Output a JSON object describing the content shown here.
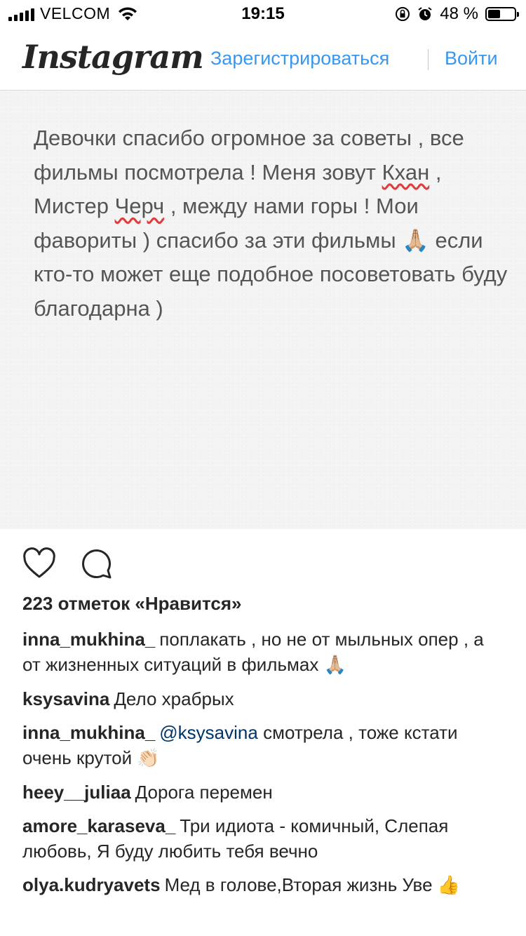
{
  "status_bar": {
    "carrier": "VELCOM",
    "time": "19:15",
    "battery": "48 %",
    "battery_level": 0.48
  },
  "nav": {
    "logo": "Instagram",
    "signup_label": "Зарегистрироваться",
    "login_label": "Войти"
  },
  "post": {
    "text_parts": {
      "p1": "Девочки спасибо огромное за советы , все фильмы посмотрела ! Меня зовут ",
      "w1": "Кхан",
      "p2": " , Мистер ",
      "w2": "Черч",
      "p3": " , между нами горы ! Мои фавориты ) спасибо за эти фильмы ",
      "emoji": "🙏🏼",
      "p4": " если кто-то может еще подобное посоветовать буду благодарна )"
    }
  },
  "actions": {
    "like_icon": "heart-icon",
    "comment_icon": "comment-icon"
  },
  "likes": "223 отметок «Нравится»",
  "comments": [
    {
      "user": "inna_mukhina_",
      "text": "поплакать , но не от мыльных опер , а от жизненных ситуаций в фильмах",
      "emoji": "🙏🏼"
    },
    {
      "user": "ksysavina",
      "text": "Дело храбрых"
    },
    {
      "user": "inna_mukhina_",
      "mention": "@ksysavina",
      "text": "смотрела , тоже кстати очень крутой",
      "emoji": "👏🏻"
    },
    {
      "user": "heey__juliaa",
      "text": "Дорога перемен"
    },
    {
      "user": "amore_karaseva_",
      "text": "Три идиота - комичный, Слепая любовь, Я буду любить тебя вечно"
    },
    {
      "user": "olya.kudryavets",
      "text": "Мед в голове,Вторая жизнь Уве",
      "emoji": "👍"
    }
  ]
}
